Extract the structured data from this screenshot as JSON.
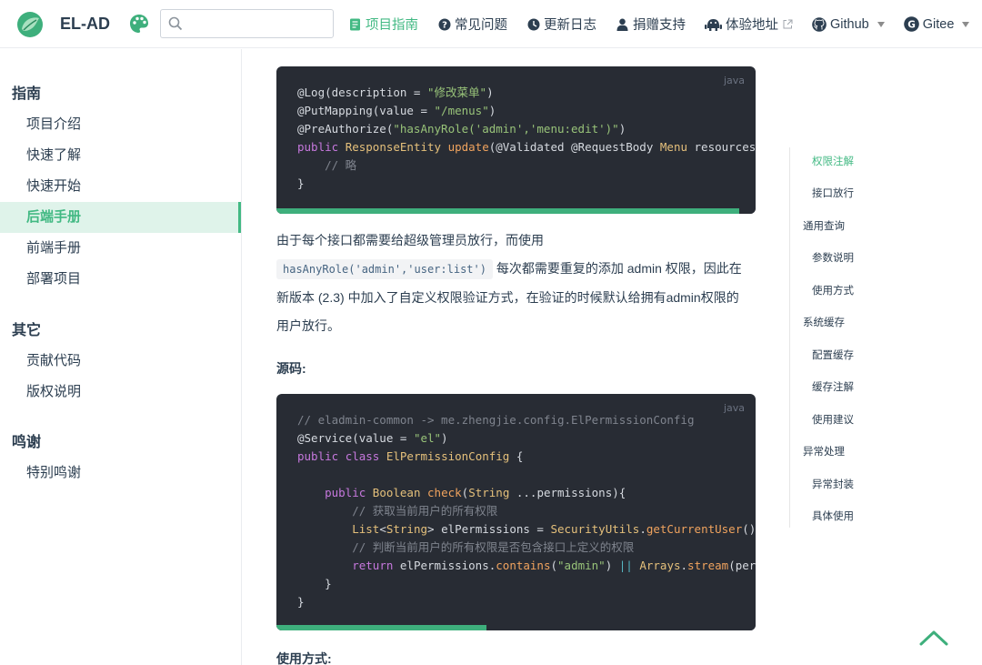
{
  "navbar": {
    "site_name": "EL-AD",
    "search": {
      "placeholder": "",
      "value": ""
    },
    "links": [
      {
        "label": "项目指南",
        "icon": "book-icon",
        "active": true
      },
      {
        "label": "常见问题",
        "icon": "question-icon"
      },
      {
        "label": "更新日志",
        "icon": "clock-icon"
      },
      {
        "label": "捐赠支持",
        "icon": "user-icon"
      },
      {
        "label": "体验地址",
        "icon": "android-icon",
        "external": true
      },
      {
        "label": "Github",
        "icon": "github-icon",
        "dropdown": true
      },
      {
        "label": "Gitee",
        "icon": "gitee-icon",
        "dropdown": true
      }
    ]
  },
  "sidebar": {
    "groups": [
      {
        "title": "指南",
        "items": [
          "项目介绍",
          "快速了解",
          "快速开始",
          "后端手册",
          "前端手册",
          "部署项目"
        ]
      },
      {
        "title": "其它",
        "items": [
          "贡献代码",
          "版权说明"
        ]
      },
      {
        "title": "鸣谢",
        "items": [
          "特别鸣谢"
        ]
      }
    ],
    "active_item": "后端手册"
  },
  "content": {
    "code1_lang": "java",
    "para1": {
      "line1": "由于每个接口都需要给超级管理员放行，而使用",
      "code": "hasAnyRole('admin','user:list')",
      "line2_after": " 每次都需要重复的添加 admin 权限，因此在",
      "line3": "新版本 (2.3) 中加入了自定义权限验证方式，在验证的时候默认给拥有admin权限的",
      "line4": "用户放行。"
    },
    "source_label": "源码:",
    "code2_lang": "java",
    "usage_label": "使用方式:"
  },
  "toc": [
    {
      "label": "权限注解",
      "level": 2,
      "active": true
    },
    {
      "label": "接口放行",
      "level": 2
    },
    {
      "label": "通用查询",
      "level": 1
    },
    {
      "label": "参数说明",
      "level": 2
    },
    {
      "label": "使用方式",
      "level": 2
    },
    {
      "label": "系统缓存",
      "level": 1
    },
    {
      "label": "配置缓存",
      "level": 2
    },
    {
      "label": "缓存注解",
      "level": 2
    },
    {
      "label": "使用建议",
      "level": 2
    },
    {
      "label": "异常处理",
      "level": 1
    },
    {
      "label": "异常封装",
      "level": 2
    },
    {
      "label": "具体使用",
      "level": 2
    }
  ],
  "colors": {
    "accent": "#42b983",
    "code_bg": "#282c34",
    "active_bg": "#dff3ea"
  }
}
